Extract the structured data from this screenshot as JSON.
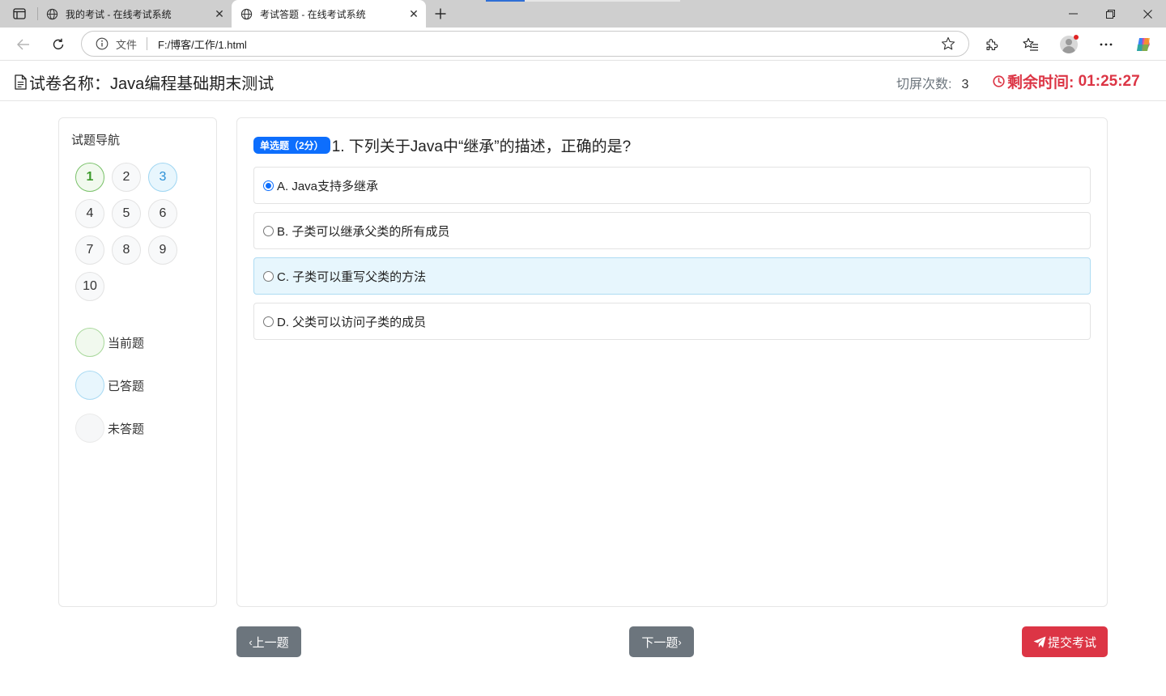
{
  "browser": {
    "tabs": [
      {
        "title": "我的考试 - 在线考试系统",
        "active": false
      },
      {
        "title": "考试答题 - 在线考试系统",
        "active": true
      }
    ],
    "address": {
      "scheme_label": "文件",
      "url": "F:/博客/工作/1.html"
    }
  },
  "header": {
    "paper_label": "试卷名称：",
    "paper_name": "Java编程基础期末测试",
    "switch_label": "切屏次数:",
    "switch_count": "3",
    "time_label": "剩余时间:",
    "time_value": "01:25:27"
  },
  "nav": {
    "title": "试题导航",
    "questions": [
      {
        "num": "1",
        "state": "current"
      },
      {
        "num": "2",
        "state": "unanswered"
      },
      {
        "num": "3",
        "state": "answered"
      },
      {
        "num": "4",
        "state": "unanswered"
      },
      {
        "num": "5",
        "state": "unanswered"
      },
      {
        "num": "6",
        "state": "unanswered"
      },
      {
        "num": "7",
        "state": "unanswered"
      },
      {
        "num": "8",
        "state": "unanswered"
      },
      {
        "num": "9",
        "state": "unanswered"
      },
      {
        "num": "10",
        "state": "unanswered"
      }
    ],
    "legend": {
      "current": "当前题",
      "answered": "已答题",
      "unanswered": "未答题"
    }
  },
  "question": {
    "badge": "单选题（2分）",
    "text": "1. 下列关于Java中“继承”的描述，正确的是?",
    "options": [
      {
        "label": "A. Java支持多继承",
        "checked": true
      },
      {
        "label": "B. 子类可以继承父类的所有成员",
        "checked": false
      },
      {
        "label": "C. 子类可以重写父类的方法",
        "checked": false
      },
      {
        "label": "D. 父类可以访问子类的成员",
        "checked": false
      }
    ]
  },
  "footer": {
    "prev": "上一题",
    "next": "下一题",
    "submit": "提交考试"
  },
  "colors": {
    "primary": "#0d6efd",
    "danger": "#dc3545",
    "secondary": "#6c757d",
    "current_green": "#7bc26b",
    "answered_blue": "#9fd6f2"
  }
}
